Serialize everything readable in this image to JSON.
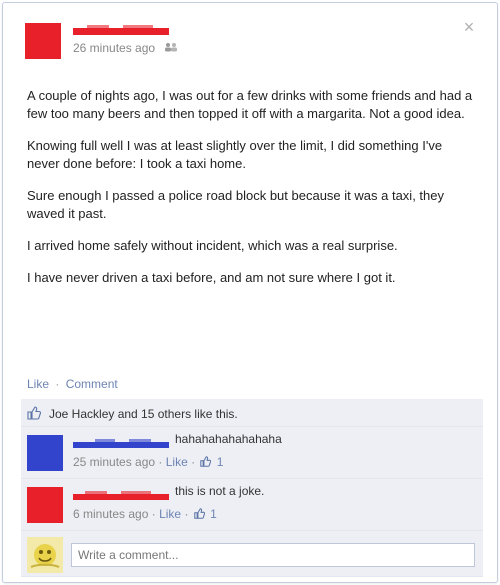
{
  "colors": {
    "accent": "#3b5998",
    "link": "#6d84b4",
    "feedback_bg": "#edeff4",
    "redact_red": "#e8202a",
    "avatar_blue": "#3344cc"
  },
  "post": {
    "author_avatar": "red-square-avatar",
    "timestamp": "26 minutes ago",
    "audience_icon": "friends-icon",
    "close_glyph": "×",
    "paragraphs": [
      "A couple of nights ago, I was out for a few drinks with some friends and had a few too many beers and then topped it off with a margarita. Not a good idea.",
      "Knowing full well I was at least slightly over the limit, I did something I've never done before: I took a taxi home.",
      "Sure enough I passed a police road block but because it was a taxi, they waved it past.",
      "I arrived home safely without incident, which was a real surprise.",
      "I have never driven a taxi before, and am not sure where I got it."
    ],
    "actions": {
      "like": "Like",
      "separator": "·",
      "comment": "Comment"
    }
  },
  "likes": {
    "text": "Joe Hackley and 15 others like this."
  },
  "comments": [
    {
      "avatar": "blue-square-avatar",
      "text": "hahahahahahahaha",
      "time": "25 minutes ago",
      "like": "Like",
      "separator": "·",
      "like_count": "1"
    },
    {
      "avatar": "red-square-avatar",
      "text": "this is not a joke.",
      "time": "6 minutes ago",
      "like": "Like",
      "separator": "·",
      "like_count": "1"
    }
  ],
  "composer": {
    "placeholder": "Write a comment..."
  }
}
